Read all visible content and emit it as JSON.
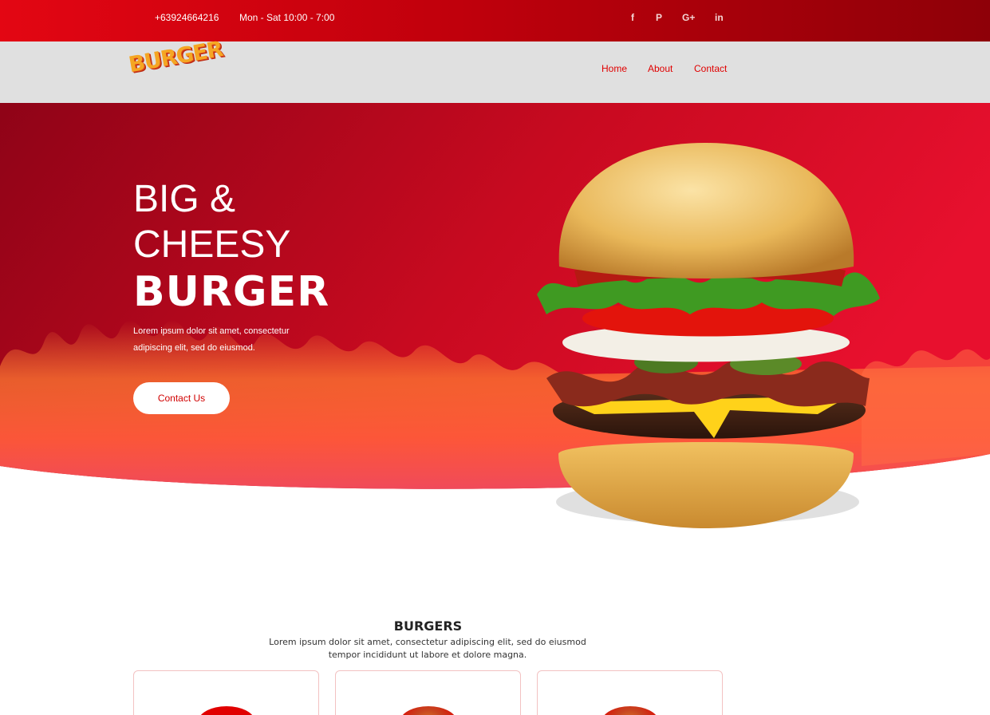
{
  "topbar": {
    "phone": "+63924664216",
    "hours": "Mon - Sat 10:00 - 7:00",
    "social": {
      "facebook": "f",
      "pinterest": "P",
      "google_plus": "G+",
      "linkedin": "in"
    }
  },
  "brand": {
    "logo_text": "BURGER"
  },
  "nav": {
    "home": "Home",
    "about": "About",
    "contact": "Contact"
  },
  "hero": {
    "line1": "BIG &",
    "line2": "CHEESY",
    "line3": "BURGER",
    "description": "Lorem ipsum dolor sit amet, consectetur adipiscing elit, sed do eiusmod.",
    "button": "Contact Us"
  },
  "burgers_section": {
    "title": "BURGERS",
    "description": "Lorem ipsum dolor sit amet, consectetur adipiscing elit, sed do eiusmod tempor incididunt ut labore et dolore magna."
  },
  "colors": {
    "brand_red": "#e30613",
    "nav_bg": "#e0e0e0",
    "link_red": "#e00000"
  },
  "icons": {
    "facebook": "facebook-icon",
    "pinterest": "pinterest-icon",
    "google_plus": "google-plus-icon",
    "linkedin": "linkedin-icon"
  }
}
